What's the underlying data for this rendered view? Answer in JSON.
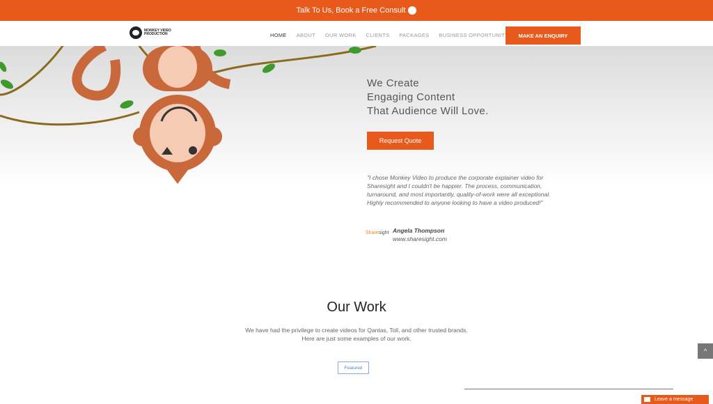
{
  "topbar": {
    "text": "Talk To Us, Book a Free Consult"
  },
  "logo": {
    "text": "MONKEY VIDEO PRODUCTION"
  },
  "nav": {
    "items": [
      "HOME",
      "ABOUT",
      "OUR WORK",
      "CLIENTS",
      "PACKAGES",
      "BUSINESS OPPORTUNITY"
    ],
    "cta": "MAKE AN ENQUIRY"
  },
  "hero": {
    "line1": "We Create",
    "line2": "Engaging Content",
    "line3": "That Audience Will Love.",
    "button": "Request Quote",
    "testimonial": "\"I chose Monkey Video to produce the corporate explainer video for Sharesight and I couldn't be happier. The process, communication, turnaround, and most importantly, quality-of-work were all exceptional. Highly recommended to anyone looking to have a video produced!\"",
    "author_name": "Angela Thompson",
    "author_site": "www.sharesight.com",
    "brand_part1": "Share",
    "brand_part2": "sight"
  },
  "our_work": {
    "title": "Our Work",
    "desc1": "We have had the privilege to create videos for Qantas, Toll, and other trusted brands.",
    "desc2": "Here are just some examples of our work.",
    "filter": "Featured"
  },
  "widget": {
    "leave_message": "Leave a message"
  },
  "colors": {
    "accent": "#e85a1c",
    "monkey": "#c9683a",
    "face": "#f6cbb4",
    "vine": "#8a6a1c",
    "leaf": "#3f9a2e"
  }
}
